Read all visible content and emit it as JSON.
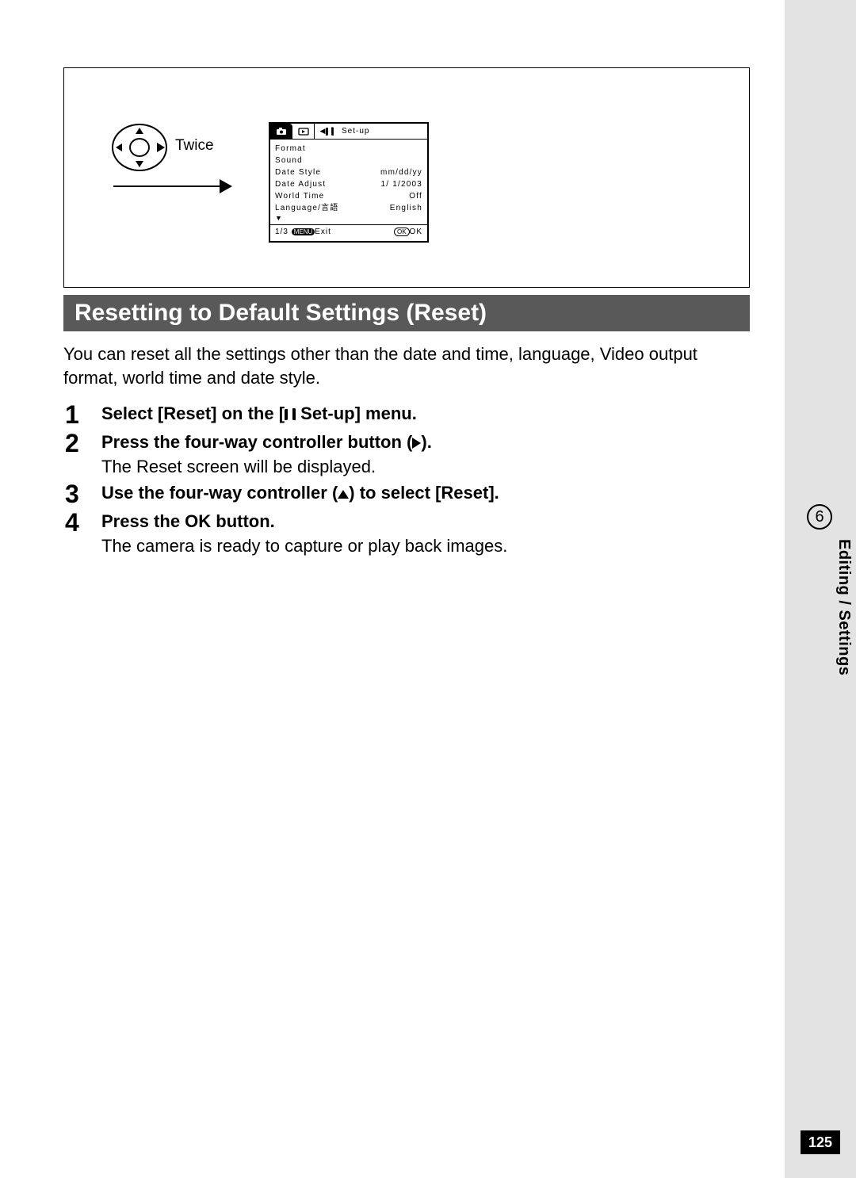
{
  "page_number": "125",
  "chapter_number": "6",
  "vertical_label": "Editing / Settings",
  "figure": {
    "twice_label": "Twice",
    "lcd": {
      "setup_label": "Set-up",
      "rows": [
        {
          "left": "Format",
          "right": ""
        },
        {
          "left": "Sound",
          "right": ""
        },
        {
          "left": "Date Style",
          "right": "mm/dd/yy"
        },
        {
          "left": "Date Adjust",
          "right": "1/ 1/2003"
        },
        {
          "left": "World Time",
          "right": "Off"
        },
        {
          "left": "Language/言語",
          "right": "English"
        }
      ],
      "footer_left_page": "1/3",
      "footer_left_menu": "MENU",
      "footer_left_exit": "Exit",
      "footer_right_ok1": "OK",
      "footer_right_ok2": "OK"
    }
  },
  "section_title": "Resetting to Default Settings (Reset)",
  "intro": "You can reset all the settings other than the date and time, language, Video output format, world time and date style.",
  "steps": [
    {
      "num": "1",
      "title_pre": "Select [Reset] on the [",
      "title_post": " Set-up] menu.",
      "desc": ""
    },
    {
      "num": "2",
      "title_pre": "Press the four-way controller button (",
      "title_post": ").",
      "desc": "The Reset screen will be displayed."
    },
    {
      "num": "3",
      "title_pre": "Use the four-way controller (",
      "title_post": ") to select [Reset].",
      "desc": ""
    },
    {
      "num": "4",
      "title_pre": "Press the OK button.",
      "title_post": "",
      "desc": "The camera is ready to capture or play back images."
    }
  ]
}
